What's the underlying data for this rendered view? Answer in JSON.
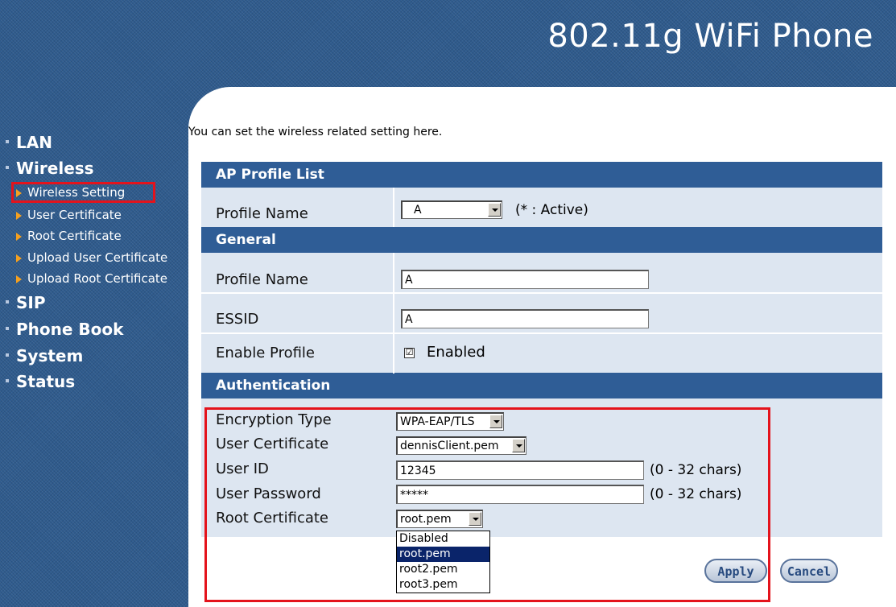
{
  "app": {
    "title": "802.11g WiFi Phone"
  },
  "sidebar": {
    "categories": [
      "LAN",
      "Wireless",
      "SIP",
      "Phone Book",
      "System",
      "Status"
    ],
    "wireless_items": [
      "Wireless Setting",
      "User Certificate",
      "Root Certificate",
      "Upload User Certificate",
      "Upload Root Certificate"
    ]
  },
  "main": {
    "intro": "You can set the wireless related setting here.",
    "ap_profile_list": {
      "header": "AP Profile List",
      "profile_label": "Profile Name",
      "profile_value": "A",
      "active_note": "(* : Active)"
    },
    "general": {
      "header": "General",
      "profile_name_label": "Profile Name",
      "profile_name_value": "A",
      "essid_label": "ESSID",
      "essid_value": "A",
      "enable_label": "Enable Profile",
      "enable_check": "☑",
      "enabled_text": "Enabled"
    },
    "authentication": {
      "header": "Authentication",
      "encryption_label": "Encryption Type",
      "encryption_value": "WPA-EAP/TLS",
      "user_cert_label": "User Certificate",
      "user_cert_value": "dennisClient.pem",
      "user_id_label": "User ID",
      "user_id_value": "12345",
      "user_id_hint": "(0 - 32 chars)",
      "password_label": "User Password",
      "password_value": "*****",
      "password_hint": "(0 - 32 chars)",
      "root_cert_label": "Root Certificate",
      "root_cert_value": "root.pem",
      "root_cert_options": [
        "Disabled",
        "root.pem",
        "root2.pem",
        "root3.pem"
      ]
    },
    "buttons": {
      "apply": "Apply",
      "cancel": "Cancel"
    }
  }
}
